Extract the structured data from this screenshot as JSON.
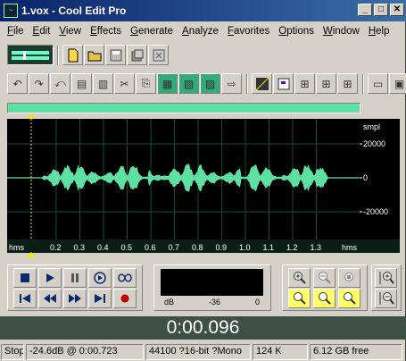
{
  "window": {
    "title": "1.vox - Cool Edit Pro",
    "app_icon": "cool-edit-icon"
  },
  "menu": [
    "File",
    "Edit",
    "View",
    "Effects",
    "Generate",
    "Analyze",
    "Favorites",
    "Options",
    "Window",
    "Help"
  ],
  "waveform": {
    "y_unit": "smpl",
    "y_ticks": [
      "20000",
      "0",
      "-20000"
    ],
    "x_unit": "hms",
    "x_ticks": [
      "0.2",
      "0.3",
      "0.4",
      "0.5",
      "0.6",
      "0.7",
      "0.8",
      "0.9",
      "1.0",
      "1.1",
      "1.2",
      "1.3"
    ],
    "colors": {
      "wave": "#5fe0a3",
      "grid": "#0f4f3a",
      "bg": "#000000",
      "cursor": "#ffe600"
    }
  },
  "level_meter": {
    "labels": [
      "dB",
      "-36",
      "0"
    ]
  },
  "time_display": "0:00.096",
  "status_bar": {
    "state": "Stop",
    "level": "-24.6dB @  0:00.723",
    "format": "44100 ?16-bit ?Mono",
    "size": "124 K",
    "free": "6.12 GB free"
  }
}
